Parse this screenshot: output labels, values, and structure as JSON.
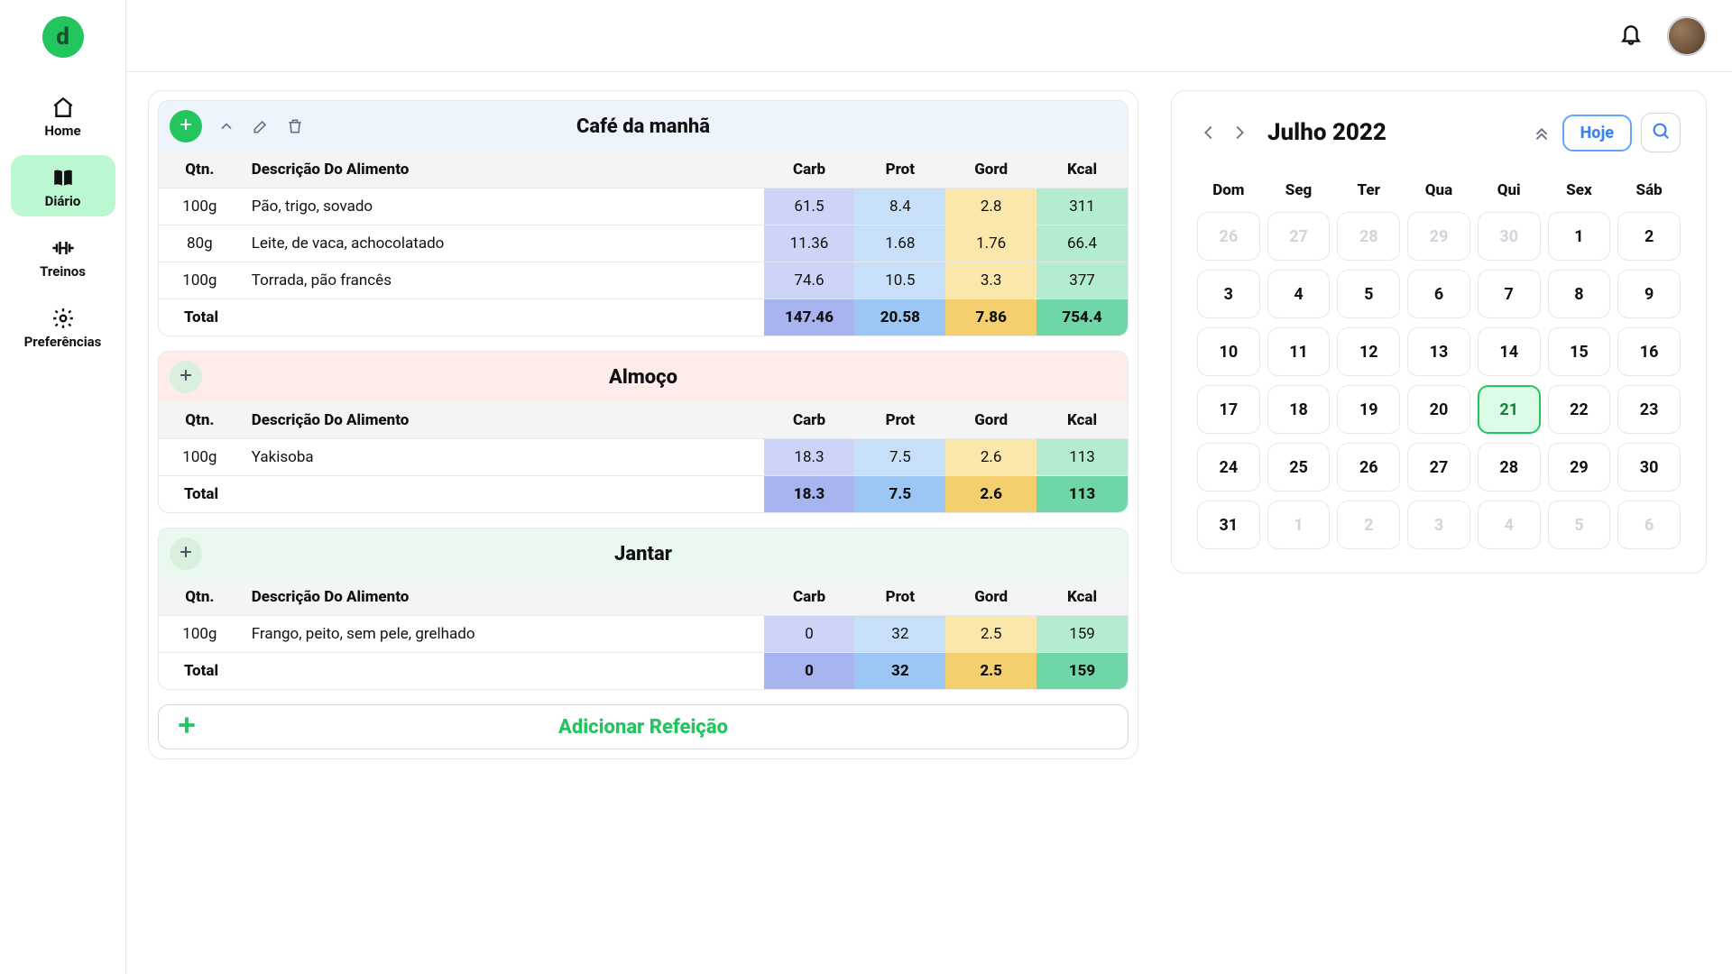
{
  "sidebar": {
    "home": "Home",
    "diary": "Diário",
    "workouts": "Treinos",
    "preferences": "Preferências"
  },
  "diary": {
    "columns": {
      "qtn": "Qtn.",
      "desc": "Descrição Do Alimento",
      "carb": "Carb",
      "prot": "Prot",
      "gord": "Gord",
      "kcal": "Kcal"
    },
    "total_label": "Total",
    "add_meal_label": "Adicionar Refeição"
  },
  "meals": [
    {
      "id": "breakfast",
      "title": "Café da manhã",
      "header_class": "hdr-blue",
      "active": true,
      "items": [
        {
          "qtn": "100g",
          "desc": "Pão, trigo, sovado",
          "carb": "61.5",
          "prot": "8.4",
          "gord": "2.8",
          "kcal": "311"
        },
        {
          "qtn": "80g",
          "desc": "Leite, de vaca, achocolatado",
          "carb": "11.36",
          "prot": "1.68",
          "gord": "1.76",
          "kcal": "66.4"
        },
        {
          "qtn": "100g",
          "desc": "Torrada, pão francês",
          "carb": "74.6",
          "prot": "10.5",
          "gord": "3.3",
          "kcal": "377"
        }
      ],
      "total": {
        "carb": "147.46",
        "prot": "20.58",
        "gord": "7.86",
        "kcal": "754.4"
      }
    },
    {
      "id": "lunch",
      "title": "Almoço",
      "header_class": "hdr-pink",
      "active": false,
      "items": [
        {
          "qtn": "100g",
          "desc": "Yakisoba",
          "carb": "18.3",
          "prot": "7.5",
          "gord": "2.6",
          "kcal": "113"
        }
      ],
      "total": {
        "carb": "18.3",
        "prot": "7.5",
        "gord": "2.6",
        "kcal": "113"
      }
    },
    {
      "id": "dinner",
      "title": "Jantar",
      "header_class": "hdr-green",
      "active": false,
      "items": [
        {
          "qtn": "100g",
          "desc": "Frango, peito, sem pele, grelhado",
          "carb": "0",
          "prot": "32",
          "gord": "2.5",
          "kcal": "159"
        }
      ],
      "total": {
        "carb": "0",
        "prot": "32",
        "gord": "2.5",
        "kcal": "159"
      }
    }
  ],
  "calendar": {
    "title": "Julho 2022",
    "today_label": "Hoje",
    "dow": [
      "Dom",
      "Seg",
      "Ter",
      "Qua",
      "Qui",
      "Sex",
      "Sáb"
    ],
    "selected": 21,
    "grid": [
      [
        {
          "n": 26,
          "o": true
        },
        {
          "n": 27,
          "o": true
        },
        {
          "n": 28,
          "o": true
        },
        {
          "n": 29,
          "o": true
        },
        {
          "n": 30,
          "o": true
        },
        {
          "n": 1
        },
        {
          "n": 2
        }
      ],
      [
        {
          "n": 3
        },
        {
          "n": 4
        },
        {
          "n": 5
        },
        {
          "n": 6
        },
        {
          "n": 7
        },
        {
          "n": 8
        },
        {
          "n": 9
        }
      ],
      [
        {
          "n": 10
        },
        {
          "n": 11
        },
        {
          "n": 12
        },
        {
          "n": 13
        },
        {
          "n": 14
        },
        {
          "n": 15
        },
        {
          "n": 16
        }
      ],
      [
        {
          "n": 17
        },
        {
          "n": 18
        },
        {
          "n": 19
        },
        {
          "n": 20
        },
        {
          "n": 21
        },
        {
          "n": 22
        },
        {
          "n": 23
        }
      ],
      [
        {
          "n": 24
        },
        {
          "n": 25
        },
        {
          "n": 26
        },
        {
          "n": 27
        },
        {
          "n": 28
        },
        {
          "n": 29
        },
        {
          "n": 30
        }
      ],
      [
        {
          "n": 31
        },
        {
          "n": 1,
          "o": true
        },
        {
          "n": 2,
          "o": true
        },
        {
          "n": 3,
          "o": true
        },
        {
          "n": 4,
          "o": true
        },
        {
          "n": 5,
          "o": true
        },
        {
          "n": 6,
          "o": true
        }
      ]
    ]
  }
}
